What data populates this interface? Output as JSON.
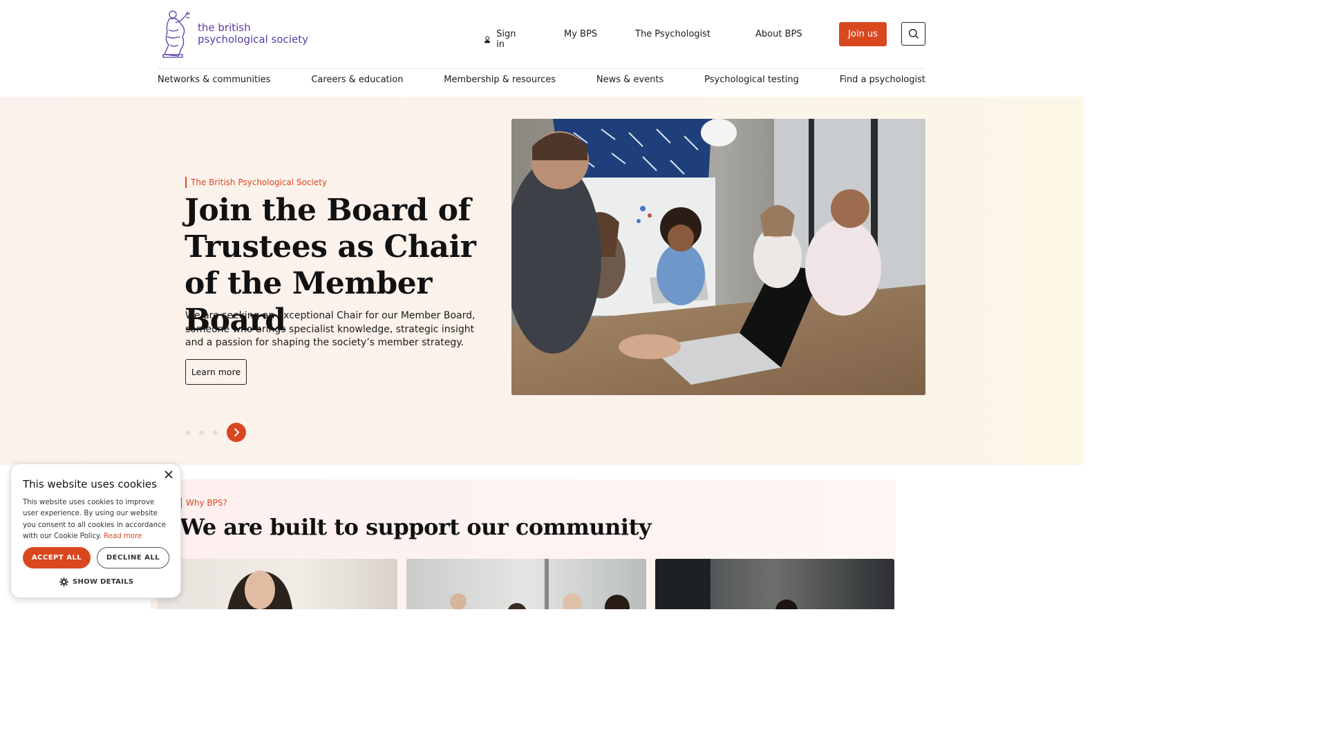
{
  "brand": {
    "logo_line1": "the british",
    "logo_line2": "psychological society",
    "logo_color": "#5b3aa6",
    "accent": "#d9471f"
  },
  "top_nav": {
    "sign_in": "Sign in",
    "my_bps": "My BPS",
    "the_psychologist": "The Psychologist",
    "about": "About BPS",
    "join": "Join us"
  },
  "main_nav": [
    "Networks & communities",
    "Careers & education",
    "Membership & resources",
    "News & events",
    "Psychological testing",
    "Find a psychologist"
  ],
  "hero": {
    "eyebrow": "The British Psychological Society",
    "title": "Join the Board of Trustees as Chair of the Member Board",
    "description": "We are seeking an exceptional Chair for our Member Board, someone who brings specialist knowledge, strategic insight and a passion for shaping the society’s member strategy.",
    "cta": "Learn more",
    "slides_count": 3
  },
  "why": {
    "eyebrow": "Why BPS?",
    "title": "We are built to support our community"
  },
  "cookie": {
    "title": "This website uses cookies",
    "text": "This website uses cookies to improve user experience. By using our website you consent to all cookies in accordance with our Cookie Policy.",
    "read_more": "Read more",
    "accept": "ACCEPT ALL",
    "decline": "DECLINE ALL",
    "details": "SHOW DETAILS"
  }
}
